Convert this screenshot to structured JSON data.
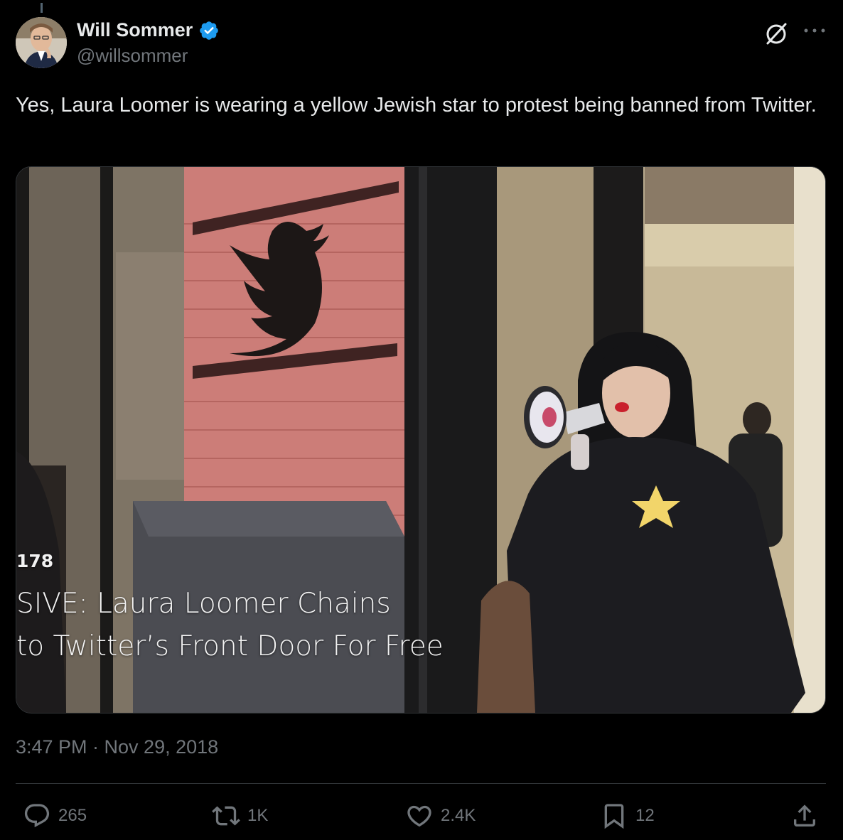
{
  "author": {
    "display_name": "Will Sommer",
    "handle": "@willsommer",
    "verified": true
  },
  "tweet": {
    "text": "Yes, Laura Loomer is wearing a yellow Jewish star to protest being banned from Twitter.",
    "timestamp": "3:47 PM · Nov 29, 2018"
  },
  "media": {
    "caption_number": "178",
    "caption_line1": "SIVE: Laura Loomer Chains",
    "caption_line2": "to Twitter’s Front Door For Free",
    "caption_line3": ""
  },
  "actions": {
    "replies": "265",
    "reposts": "1K",
    "likes": "2.4K",
    "bookmarks": "12"
  },
  "icons": {
    "reply": "reply-icon",
    "repost": "repost-icon",
    "like": "heart-icon",
    "bookmark": "bookmark-icon",
    "share": "share-icon",
    "grok": "grok-icon",
    "more": "more-icon",
    "verified": "verified-badge-icon"
  },
  "colors": {
    "background": "#000000",
    "text": "#e7e9ea",
    "secondary": "#71767b",
    "verified_blue": "#1d9bf0",
    "divider": "#2f3336"
  }
}
